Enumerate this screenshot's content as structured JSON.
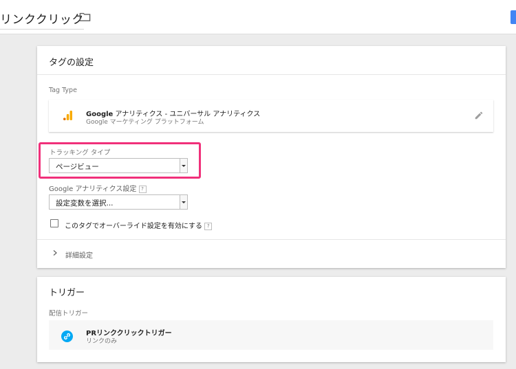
{
  "header": {
    "title": "リンククリック",
    "folder_icon": "folder-icon"
  },
  "tag_config": {
    "title": "タグの設定",
    "tag_type_label": "Tag Type",
    "tag_type": {
      "name_bold": "Google",
      "name_rest": " アナリティクス - ユニバーサル アナリティクス",
      "subtitle": "Google マーケティング プラットフォーム",
      "icon": "analytics-icon",
      "edit_icon": "edit-icon"
    },
    "tracking_type": {
      "label": "トラッキング タイプ",
      "value": "ページビュー"
    },
    "ga_settings": {
      "label": "Google アナリティクス設定",
      "value": "設定変数を選択...",
      "help": "?"
    },
    "override": {
      "label": "このタグでオーバーライド設定を有効にする",
      "help": "?",
      "checked": false
    },
    "advanced_label": "詳細設定"
  },
  "trigger": {
    "title": "トリガー",
    "firing_label": "配信トリガー",
    "item": {
      "name": "PRリンククリックトリガー",
      "subtitle": "リンクのみ",
      "icon": "link-icon"
    }
  },
  "colors": {
    "highlight": "#f0307a",
    "accent_blue": "#4285f4",
    "trigger_icon": "#03a9f4",
    "analytics_orange": "#f9ab00"
  }
}
